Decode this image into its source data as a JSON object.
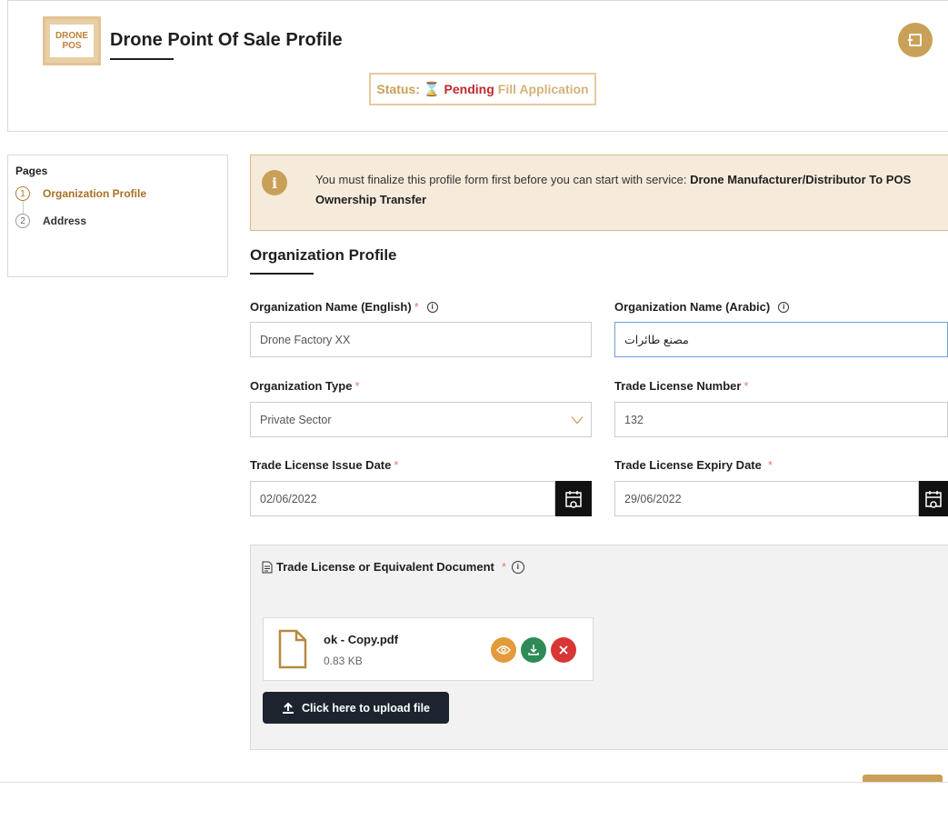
{
  "header": {
    "logo_line1": "DRONE",
    "logo_line2": "POS",
    "title": "Drone Point Of Sale Profile",
    "status_label": "Status:",
    "status_value": "Pending",
    "status_detail": "Fill Application"
  },
  "sidebar": {
    "title": "Pages",
    "steps": [
      {
        "num": "1",
        "label": "Organization Profile",
        "active": true
      },
      {
        "num": "2",
        "label": "Address",
        "active": false
      }
    ]
  },
  "banner": {
    "text": "You must finalize this profile form first before you can start with service:",
    "service": "Drone Manufacturer/Distributor To POS Ownership Transfer"
  },
  "section": {
    "title": "Organization Profile"
  },
  "fields": {
    "org_name_en": {
      "label": "Organization Name (English)",
      "value": "Drone Factory XX"
    },
    "org_name_ar": {
      "label": "Organization Name (Arabic)",
      "value": "مصنع طائرات"
    },
    "org_type": {
      "label": "Organization Type",
      "value": "Private Sector"
    },
    "trade_license_number": {
      "label": "Trade License Number",
      "value": "132"
    },
    "issue_date": {
      "label": "Trade License Issue Date",
      "value": "02/06/2022"
    },
    "expiry_date": {
      "label": "Trade License Expiry Date",
      "value": "29/06/2022"
    }
  },
  "upload": {
    "label": "Trade License or Equivalent Document",
    "file_name": "ok - Copy.pdf",
    "file_size": "0.83 KB",
    "upload_button": "Click here to upload file"
  },
  "colors": {
    "accent": "#c9a057",
    "danger": "#c0282d",
    "success": "#2e8b57"
  }
}
